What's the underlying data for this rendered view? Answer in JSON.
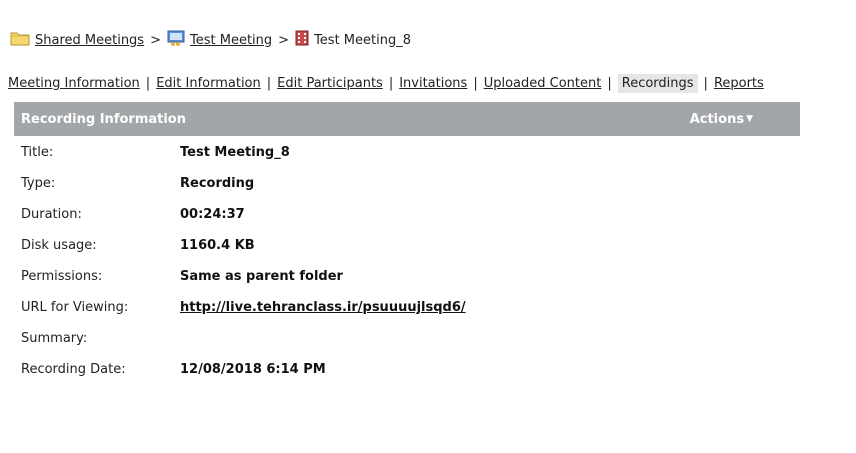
{
  "breadcrumb": {
    "items": [
      {
        "label": "Shared Meetings",
        "icon": "folder-icon"
      },
      {
        "label": "Test Meeting",
        "icon": "meeting-icon"
      },
      {
        "label": "Test Meeting_8",
        "icon": "recording-icon"
      }
    ],
    "separator": ">"
  },
  "tabs": {
    "items": [
      {
        "label": "Meeting Information"
      },
      {
        "label": "Edit Information"
      },
      {
        "label": "Edit Participants"
      },
      {
        "label": "Invitations"
      },
      {
        "label": "Uploaded Content"
      },
      {
        "label": "Recordings",
        "active": true
      },
      {
        "label": "Reports"
      }
    ],
    "separator": "|"
  },
  "panel": {
    "title": "Recording Information",
    "actions_label": "Actions",
    "actions_caret": "▼",
    "header_color": "#a3a6a8"
  },
  "info": {
    "rows": [
      {
        "label": "Title:",
        "value": "Test Meeting_8"
      },
      {
        "label": "Type:",
        "value": "Recording"
      },
      {
        "label": "Duration:",
        "value": "00:24:37"
      },
      {
        "label": "Disk usage:",
        "value": "1160.4 KB"
      },
      {
        "label": "Permissions:",
        "value": "Same as parent folder"
      },
      {
        "label": "URL for Viewing:",
        "value": "http://live.tehranclass.ir/psuuuujlsqd6/"
      },
      {
        "label": "Summary:",
        "value": ""
      },
      {
        "label": "Recording Date:",
        "value": "12/08/2018 6:14 PM"
      }
    ]
  }
}
